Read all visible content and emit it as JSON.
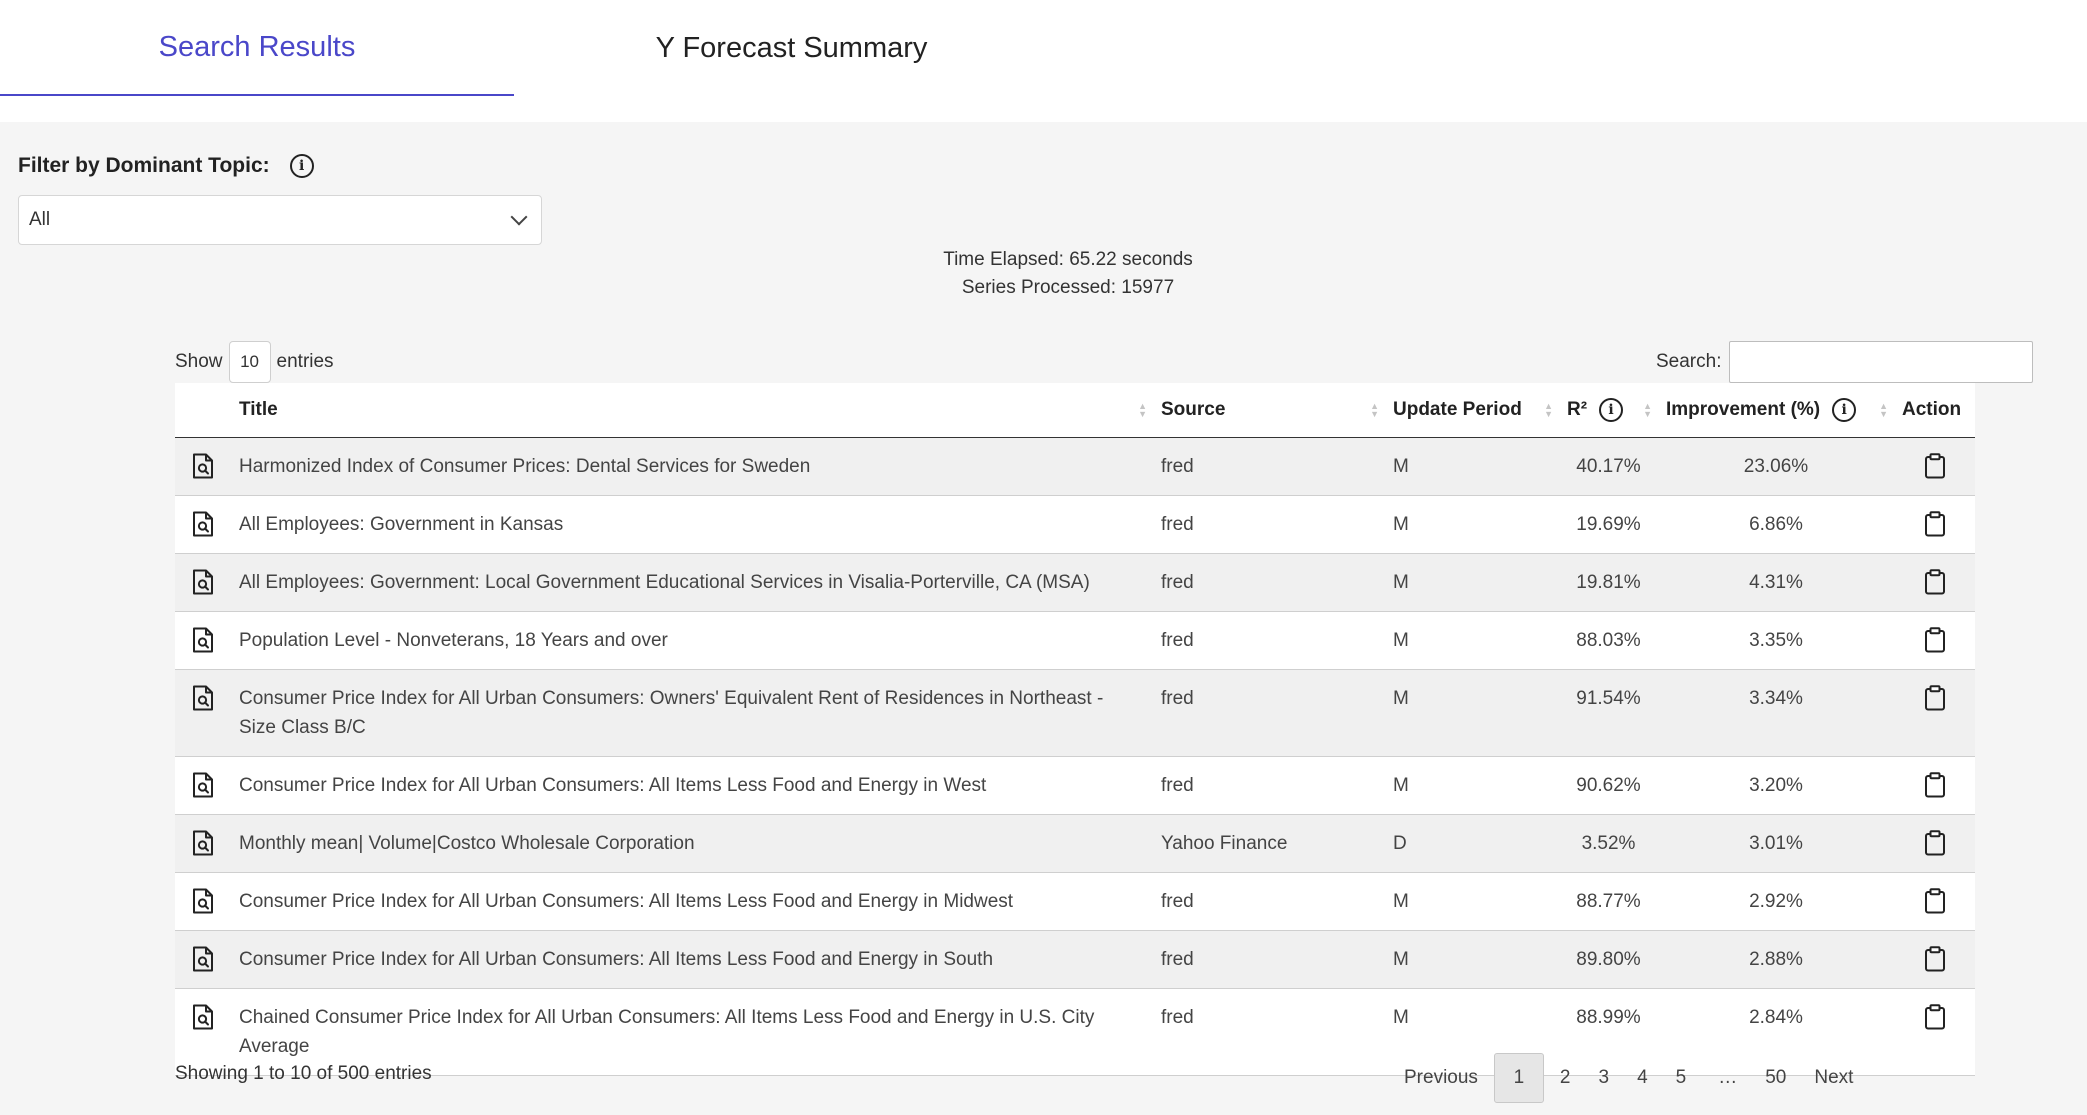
{
  "tabs": {
    "search_results": "Search Results",
    "forecast_summary": "Y Forecast Summary"
  },
  "filter": {
    "label": "Filter by Dominant Topic:",
    "selected": "All"
  },
  "stats": {
    "time_elapsed": "Time Elapsed: 65.22 seconds",
    "series_processed": "Series Processed: 15977"
  },
  "length_menu": {
    "show": "Show",
    "value": "10",
    "entries": "entries"
  },
  "search": {
    "label": "Search:",
    "value": ""
  },
  "table": {
    "headers": {
      "title": "Title",
      "source": "Source",
      "update_period": "Update Period",
      "r2": "R²",
      "improvement": "Improvement (%)",
      "action": "Action"
    },
    "rows": [
      {
        "title": "Harmonized Index of Consumer Prices: Dental Services for Sweden",
        "source": "fred",
        "period": "M",
        "r2": "40.17%",
        "improvement": "23.06%"
      },
      {
        "title": "All Employees: Government in Kansas",
        "source": "fred",
        "period": "M",
        "r2": "19.69%",
        "improvement": "6.86%"
      },
      {
        "title": "All Employees: Government: Local Government Educational Services in Visalia-Porterville, CA (MSA)",
        "source": "fred",
        "period": "M",
        "r2": "19.81%",
        "improvement": "4.31%"
      },
      {
        "title": "Population Level - Nonveterans, 18 Years and over",
        "source": "fred",
        "period": "M",
        "r2": "88.03%",
        "improvement": "3.35%"
      },
      {
        "title": "Consumer Price Index for All Urban Consumers: Owners' Equivalent Rent of Residences in Northeast - Size Class B/C",
        "source": "fred",
        "period": "M",
        "r2": "91.54%",
        "improvement": "3.34%"
      },
      {
        "title": "Consumer Price Index for All Urban Consumers: All Items Less Food and Energy in West",
        "source": "fred",
        "period": "M",
        "r2": "90.62%",
        "improvement": "3.20%"
      },
      {
        "title": "Monthly mean| Volume|Costco Wholesale Corporation",
        "source": "Yahoo Finance",
        "period": "D",
        "r2": "3.52%",
        "improvement": "3.01%"
      },
      {
        "title": "Consumer Price Index for All Urban Consumers: All Items Less Food and Energy in Midwest",
        "source": "fred",
        "period": "M",
        "r2": "88.77%",
        "improvement": "2.92%"
      },
      {
        "title": "Consumer Price Index for All Urban Consumers: All Items Less Food and Energy in South",
        "source": "fred",
        "period": "M",
        "r2": "89.80%",
        "improvement": "2.88%"
      },
      {
        "title": "Chained Consumer Price Index for All Urban Consumers: All Items Less Food and Energy in U.S. City Average",
        "source": "fred",
        "period": "M",
        "r2": "88.99%",
        "improvement": "2.84%"
      }
    ]
  },
  "footer": {
    "info": "Showing 1 to 10 of 500 entries"
  },
  "pagination": {
    "previous": "Previous",
    "pages": [
      "1",
      "2",
      "3",
      "4",
      "5",
      "…",
      "50"
    ],
    "active": "1",
    "next": "Next"
  },
  "icons": {
    "row_icon": "document-search-icon",
    "action_icon": "clipboard-icon",
    "info_icon": "info-circle-icon"
  }
}
